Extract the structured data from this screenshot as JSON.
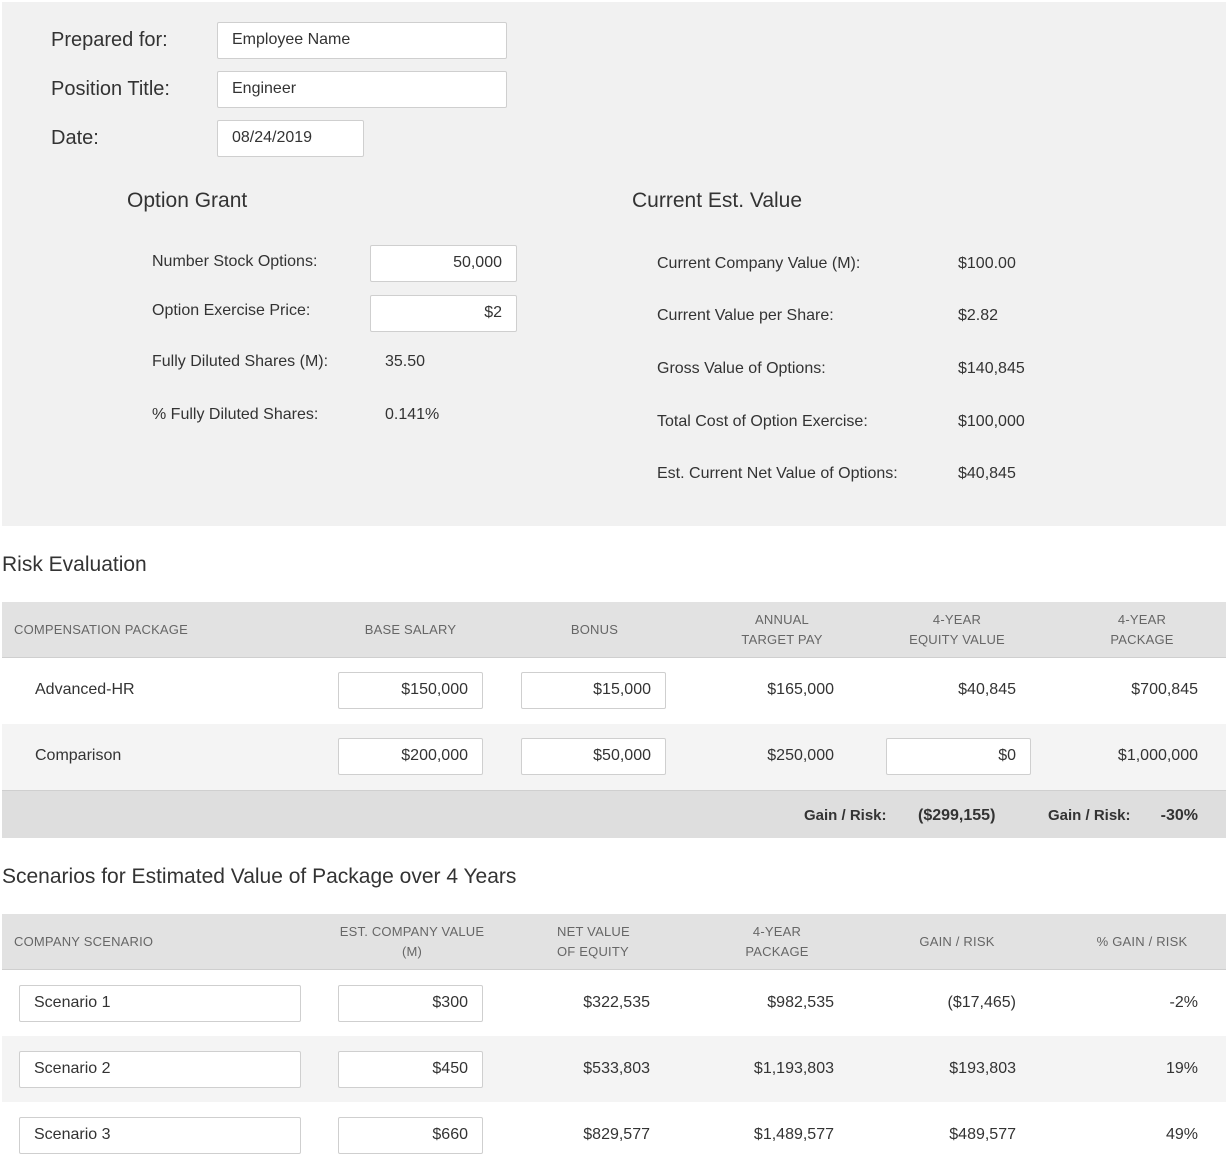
{
  "header": {
    "prepared_for_label": "Prepared for:",
    "prepared_for_value": "Employee Name",
    "position_title_label": "Position Title:",
    "position_title_value": "Engineer",
    "date_label": "Date:",
    "date_value": "08/24/2019"
  },
  "option_grant": {
    "title": "Option Grant",
    "number_options_label": "Number Stock Options:",
    "number_options_value": "50,000",
    "exercise_price_label": "Option Exercise Price:",
    "exercise_price_value": "$2",
    "fully_diluted_label": "Fully Diluted Shares (M):",
    "fully_diluted_value": "35.50",
    "pct_diluted_label": "% Fully Diluted Shares:",
    "pct_diluted_value": "0.141%"
  },
  "current_value": {
    "title": "Current Est. Value",
    "rows": [
      {
        "label": "Current Company Value (M):",
        "value": "$100.00"
      },
      {
        "label": "Current Value per Share:",
        "value": "$2.82"
      },
      {
        "label": "Gross Value of Options:",
        "value": "$140,845"
      },
      {
        "label": "Total Cost of Option Exercise:",
        "value": "$100,000"
      },
      {
        "label": "Est. Current Net Value of Options:",
        "value": "$40,845"
      }
    ]
  },
  "risk": {
    "title": "Risk Evaluation",
    "headers": {
      "package": "COMPENSATION PACKAGE",
      "base": "BASE SALARY",
      "bonus": "BONUS",
      "annual_1": "ANNUAL",
      "annual_2": "TARGET PAY",
      "equity_1": "4-YEAR",
      "equity_2": "EQUITY VALUE",
      "pkg4_1": "4-YEAR",
      "pkg4_2": "PACKAGE"
    },
    "rows": [
      {
        "name": "Advanced-HR",
        "base": "$150,000",
        "bonus": "$15,000",
        "annual": "$165,000",
        "equity": "$40,845",
        "package": "$700,845"
      },
      {
        "name": "Comparison",
        "base": "$200,000",
        "bonus": "$50,000",
        "annual": "$250,000",
        "equity": "$0",
        "package": "$1,000,000"
      }
    ],
    "footer": {
      "gain_label_1": "Gain / Risk:",
      "gain_value_1": "($299,155)",
      "gain_label_2": "Gain / Risk:",
      "gain_value_2": "-30%"
    }
  },
  "scenarios": {
    "title": "Scenarios for Estimated Value of Package over 4 Years",
    "headers": {
      "scenario": "COMPANY SCENARIO",
      "value_1": "EST. COMPANY VALUE",
      "value_2": "(M)",
      "equity_1": "NET VALUE",
      "equity_2": "OF EQUITY",
      "pkg_1": "4-YEAR",
      "pkg_2": "PACKAGE",
      "gain": "GAIN / RISK",
      "pct": "% GAIN / RISK"
    },
    "rows": [
      {
        "name": "Scenario 1",
        "value": "$300",
        "equity": "$322,535",
        "package": "$982,535",
        "gain": "($17,465)",
        "pct": "-2%"
      },
      {
        "name": "Scenario 2",
        "value": "$450",
        "equity": "$533,803",
        "package": "$1,193,803",
        "gain": "$193,803",
        "pct": "19%"
      },
      {
        "name": "Scenario 3",
        "value": "$660",
        "equity": "$829,577",
        "package": "$1,489,577",
        "gain": "$489,577",
        "pct": "49%"
      }
    ]
  }
}
